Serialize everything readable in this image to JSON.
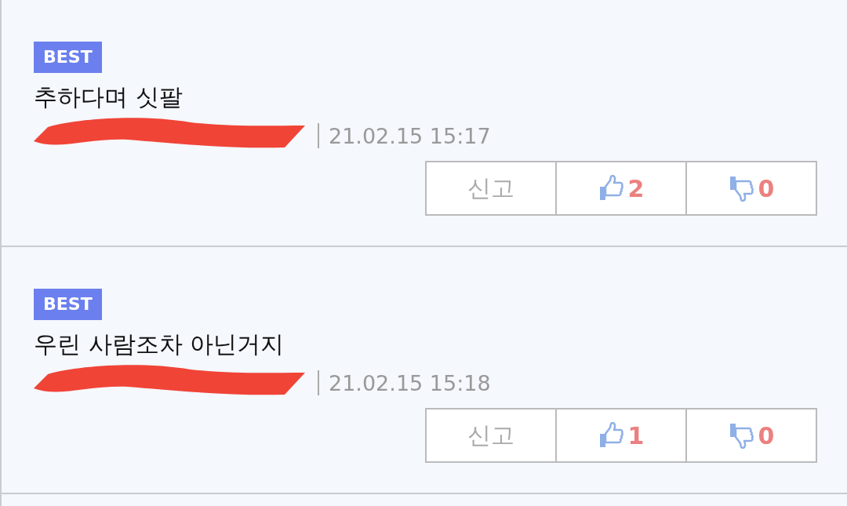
{
  "comments": [
    {
      "badge": "BEST",
      "text": "추하다며 싯팔",
      "author_redacted": true,
      "date": "21.02.15 15:17",
      "report": "신고",
      "likes": "2",
      "dislikes": "0"
    },
    {
      "badge": "BEST",
      "text": "우린 사람조차 아닌거지",
      "author_redacted": true,
      "date": "21.02.15 15:18",
      "report": "신고",
      "likes": "1",
      "dislikes": "0"
    }
  ]
}
